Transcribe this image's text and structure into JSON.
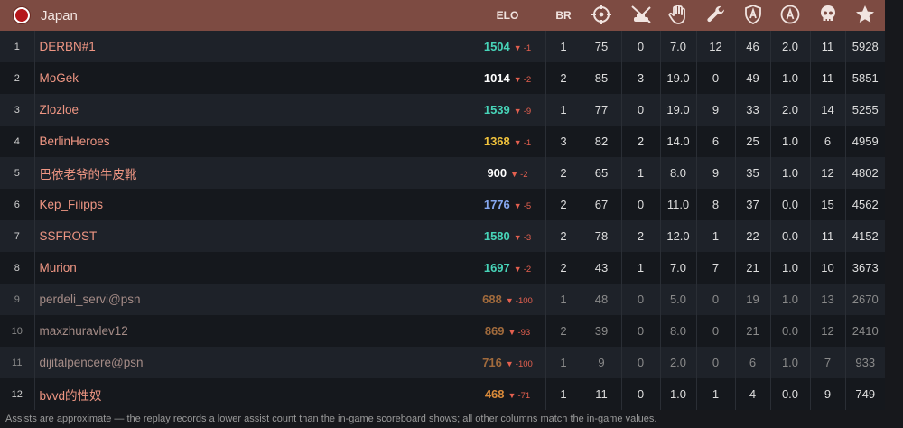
{
  "team": {
    "name": "Japan"
  },
  "columns": {
    "elo": "ELO",
    "br": "BR",
    "icons": [
      "crosshair-icon",
      "ground-kills-icon",
      "hand-icon",
      "wrench-icon",
      "shield-a-icon",
      "circle-a-icon",
      "skull-icon",
      "star-icon"
    ]
  },
  "colors": {
    "header_bg": "#7d4b42",
    "flag_red": "#b5171b",
    "name_color": "#ef9683",
    "delta_red": "#e4604f",
    "elo_teal": "#47d4b8",
    "elo_white": "#ffffff",
    "elo_gold": "#f0c23c",
    "elo_blue": "#86a8f0",
    "elo_orange": "#d98a3a",
    "elo_brown": "#a06a3c"
  },
  "players": [
    {
      "num": "1",
      "name": "DERBN#1",
      "elo": "1504",
      "delta": "-1",
      "elo_color": "#47d4b8",
      "br": "1",
      "c1": "75",
      "c2": "0",
      "c3": "7.0",
      "c4": "12",
      "c5": "46",
      "c6": "2.0",
      "c7": "11",
      "c8": "5928",
      "dim": false
    },
    {
      "num": "2",
      "name": "MoGek",
      "elo": "1014",
      "delta": "-2",
      "elo_color": "#ffffff",
      "br": "2",
      "c1": "85",
      "c2": "3",
      "c3": "19.0",
      "c4": "0",
      "c5": "49",
      "c6": "1.0",
      "c7": "11",
      "c8": "5851",
      "dim": false
    },
    {
      "num": "3",
      "name": "Zlozloe",
      "elo": "1539",
      "delta": "-9",
      "elo_color": "#47d4b8",
      "br": "1",
      "c1": "77",
      "c2": "0",
      "c3": "19.0",
      "c4": "9",
      "c5": "33",
      "c6": "2.0",
      "c7": "14",
      "c8": "5255",
      "dim": false
    },
    {
      "num": "4",
      "name": "BerlinHeroes",
      "elo": "1368",
      "delta": "-1",
      "elo_color": "#f0c23c",
      "br": "3",
      "c1": "82",
      "c2": "2",
      "c3": "14.0",
      "c4": "6",
      "c5": "25",
      "c6": "1.0",
      "c7": "6",
      "c8": "4959",
      "dim": false
    },
    {
      "num": "5",
      "name": "巴依老爷的牛皮靴",
      "elo": "900",
      "delta": "-2",
      "elo_color": "#ffffff",
      "br": "2",
      "c1": "65",
      "c2": "1",
      "c3": "8.0",
      "c4": "9",
      "c5": "35",
      "c6": "1.0",
      "c7": "12",
      "c8": "4802",
      "dim": false
    },
    {
      "num": "6",
      "name": "Kep_Filipps",
      "elo": "1776",
      "delta": "-5",
      "elo_color": "#86a8f0",
      "br": "2",
      "c1": "67",
      "c2": "0",
      "c3": "11.0",
      "c4": "8",
      "c5": "37",
      "c6": "0.0",
      "c7": "15",
      "c8": "4562",
      "dim": false
    },
    {
      "num": "7",
      "name": "SSFROST",
      "elo": "1580",
      "delta": "-3",
      "elo_color": "#47d4b8",
      "br": "2",
      "c1": "78",
      "c2": "2",
      "c3": "12.0",
      "c4": "1",
      "c5": "22",
      "c6": "0.0",
      "c7": "11",
      "c8": "4152",
      "dim": false
    },
    {
      "num": "8",
      "name": "Murion",
      "elo": "1697",
      "delta": "-2",
      "elo_color": "#47d4b8",
      "br": "2",
      "c1": "43",
      "c2": "1",
      "c3": "7.0",
      "c4": "7",
      "c5": "21",
      "c6": "1.0",
      "c7": "10",
      "c8": "3673",
      "dim": false
    },
    {
      "num": "9",
      "name": "perdeli_servi@psn",
      "elo": "688",
      "delta": "-100",
      "elo_color": "#a06a3c",
      "br": "1",
      "c1": "48",
      "c2": "0",
      "c3": "5.0",
      "c4": "0",
      "c5": "19",
      "c6": "1.0",
      "c7": "13",
      "c8": "2670",
      "dim": true
    },
    {
      "num": "10",
      "name": "maxzhuravlev12",
      "elo": "869",
      "delta": "-93",
      "elo_color": "#a06a3c",
      "br": "2",
      "c1": "39",
      "c2": "0",
      "c3": "8.0",
      "c4": "0",
      "c5": "21",
      "c6": "0.0",
      "c7": "12",
      "c8": "2410",
      "dim": true
    },
    {
      "num": "11",
      "name": "dijitalpencere@psn",
      "elo": "716",
      "delta": "-100",
      "elo_color": "#a06a3c",
      "br": "1",
      "c1": "9",
      "c2": "0",
      "c3": "2.0",
      "c4": "0",
      "c5": "6",
      "c6": "1.0",
      "c7": "7",
      "c8": "933",
      "dim": true
    },
    {
      "num": "12",
      "name": "bvvd的性奴",
      "elo": "468",
      "delta": "-71",
      "elo_color": "#d98a3a",
      "br": "1",
      "c1": "11",
      "c2": "0",
      "c3": "1.0",
      "c4": "1",
      "c5": "4",
      "c6": "0.0",
      "c7": "9",
      "c8": "749",
      "dim": false
    }
  ],
  "footnote": "Assists are approximate — the replay records a lower assist count than the in-game scoreboard shows; all other columns match the in-game values."
}
